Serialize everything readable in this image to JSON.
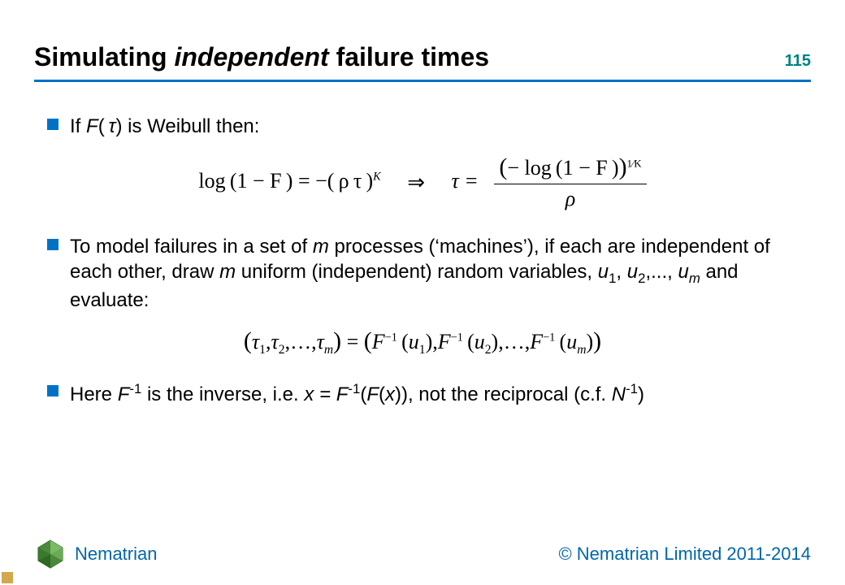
{
  "header": {
    "title_prefix": "Simulating ",
    "title_italic": "independent",
    "title_suffix": " failure times",
    "slide_number": "115"
  },
  "bullets": {
    "b1_prefix": "If ",
    "b1_func": "F",
    "b1_paren_open": "( ",
    "b1_tau": "τ",
    "b1_paren_close": ") is Weibull then:",
    "b2": "To model failures in a set of ",
    "b2_m1": "m",
    "b2_mid": " processes (‘machines’), if each are independent of each other, draw ",
    "b2_m2": "m",
    "b2_mid2": " uniform (independent) random variables, ",
    "b2_u": "u",
    "b2_s1": "1",
    "b2_c1": ", ",
    "b2_s2": "2",
    "b2_c2": ",..., ",
    "b2_sm": "m",
    "b2_tail": " and evaluate:",
    "b3_prefix": "Here ",
    "b3_F": "F",
    "b3_sup1": "-1",
    "b3_mid": " is the inverse, i.e. ",
    "b3_x1": "x = F",
    "b3_sup2": "-1",
    "b3_paren": "(",
    "b3_Fx": "F",
    "b3_paren2": "(",
    "b3_x2": "x",
    "b3_paren3": ")), not the reciprocal (c.f. ",
    "b3_N": "N",
    "b3_sup3": "-1",
    "b3_close": ")"
  },
  "equations": {
    "eq1_lhs": "log (1 − F ) = −( ρ τ )",
    "eq1_sup": "K",
    "eq1_arrow": "⇒",
    "eq1_tau_eq": "τ =",
    "eq1_num_open": "(",
    "eq1_num_body": "− log (1 − F )",
    "eq1_num_close": ")",
    "eq1_num_sup": "1⁄K",
    "eq1_den": "ρ",
    "eq2_lhs_open": "(",
    "eq2_t": "τ",
    "eq2_s1": "1",
    "eq2_comma": ",",
    "eq2_s2": "2",
    "eq2_dots": ",…,",
    "eq2_sm": "m",
    "eq2_lhs_close": ")",
    "eq2_eq": " = ",
    "eq2_rhs_open": "(",
    "eq2_F": "F",
    "eq2_inv": "−1",
    "eq2_po": "(",
    "eq2_u": "u",
    "eq2_pc": ")",
    "eq2_rhs_close": ")"
  },
  "footer": {
    "brand": "Nematrian",
    "copyright": "© Nematrian Limited 2011-2014"
  },
  "chart_data": {
    "type": "table",
    "title": "Simulating independent failure times",
    "slide_number": 115,
    "equations": [
      "log(1 - F) = -(ρτ)^K  ⇒  τ = (-log(1 - F))^{1/K} / ρ",
      "(τ_1, τ_2, ..., τ_m) = (F^{-1}(u_1), F^{-1}(u_2), ..., F^{-1}(u_m))"
    ],
    "notes": [
      "If F(τ) is Weibull then the first equation holds",
      "To model failures in a set of m processes ('machines'), if each are independent of each other, draw m uniform (independent) random variables u_1, u_2, ..., u_m and evaluate the second equation",
      "Here F^{-1} is the inverse, i.e. x = F^{-1}(F(x)), not the reciprocal (c.f. N^{-1})"
    ]
  }
}
